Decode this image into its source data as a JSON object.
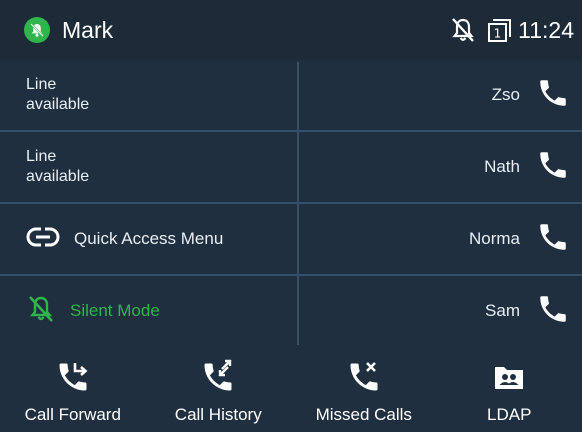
{
  "status": {
    "account_name": "Mark",
    "time": "11:24",
    "line_badge": "1",
    "presence_color": "#2fb54b",
    "icons": [
      "presence-dnd-icon",
      "bell-off-icon",
      "line-key-icon"
    ]
  },
  "rows": [
    {
      "left": {
        "line1": "Line",
        "line2": "available"
      },
      "contact": "Zso"
    },
    {
      "left": {
        "line1": "Line",
        "line2": "available"
      },
      "contact": "Nath"
    },
    {
      "left": {
        "label": "Quick Access Menu",
        "icon": "link-icon"
      },
      "contact": "Norma"
    },
    {
      "left": {
        "label": "Silent Mode",
        "icon": "bell-off-icon",
        "color": "#2fb54b"
      },
      "contact": "Sam"
    }
  ],
  "softkeys": [
    {
      "label": "Call Forward",
      "icon": "call-forward-icon"
    },
    {
      "label": "Call History",
      "icon": "call-history-icon"
    },
    {
      "label": "Missed Calls",
      "icon": "missed-calls-icon"
    },
    {
      "label": "LDAP",
      "icon": "ldap-directory-icon"
    }
  ],
  "colors": {
    "accent_green": "#2fb54b",
    "handset_orange": "#f0a030",
    "background": "#1f2f3f",
    "separator": "#34506a"
  }
}
